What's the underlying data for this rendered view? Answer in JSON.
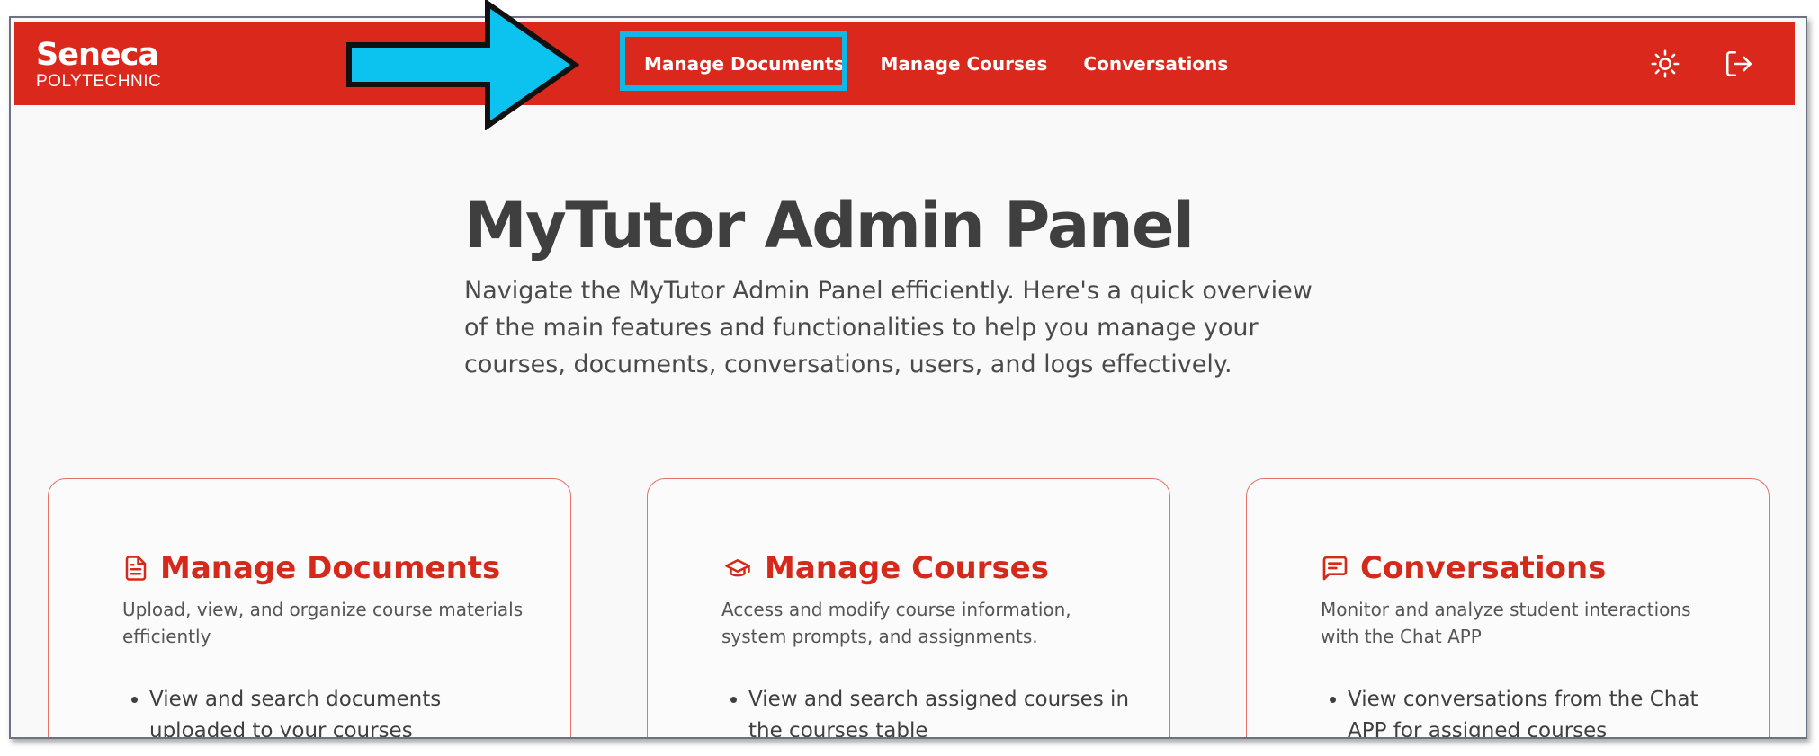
{
  "header": {
    "logo": {
      "main": "Seneca",
      "sub": "POLYTECHNIC"
    },
    "nav": [
      {
        "label": "Manage Documents"
      },
      {
        "label": "Manage Courses"
      },
      {
        "label": "Conversations"
      }
    ],
    "icons": [
      "sun-icon",
      "logout-icon"
    ]
  },
  "hero": {
    "title": "MyTutor Admin Panel",
    "description": "Navigate the MyTutor Admin Panel efficiently. Here's a quick overview of the main features and functionalities to help you manage your courses, documents, conversations, users, and logs effectively."
  },
  "cards": [
    {
      "icon": "document-icon",
      "title": "Manage Documents",
      "description": "Upload, view, and organize course materials efficiently",
      "items": [
        "View and search documents uploaded to your courses"
      ]
    },
    {
      "icon": "graduation-cap-icon",
      "title": "Manage Courses",
      "description": "Access and modify course information, system prompts, and assignments.",
      "items": [
        "View and search assigned courses in the courses table"
      ]
    },
    {
      "icon": "chat-icon",
      "title": "Conversations",
      "description": "Monitor and analyze student interactions with the Chat APP",
      "items": [
        "View conversations from the Chat APP for assigned courses"
      ]
    }
  ],
  "colors": {
    "brand_red": "#da291c",
    "highlight": "#10b8e8",
    "card_border": "#e57368"
  }
}
